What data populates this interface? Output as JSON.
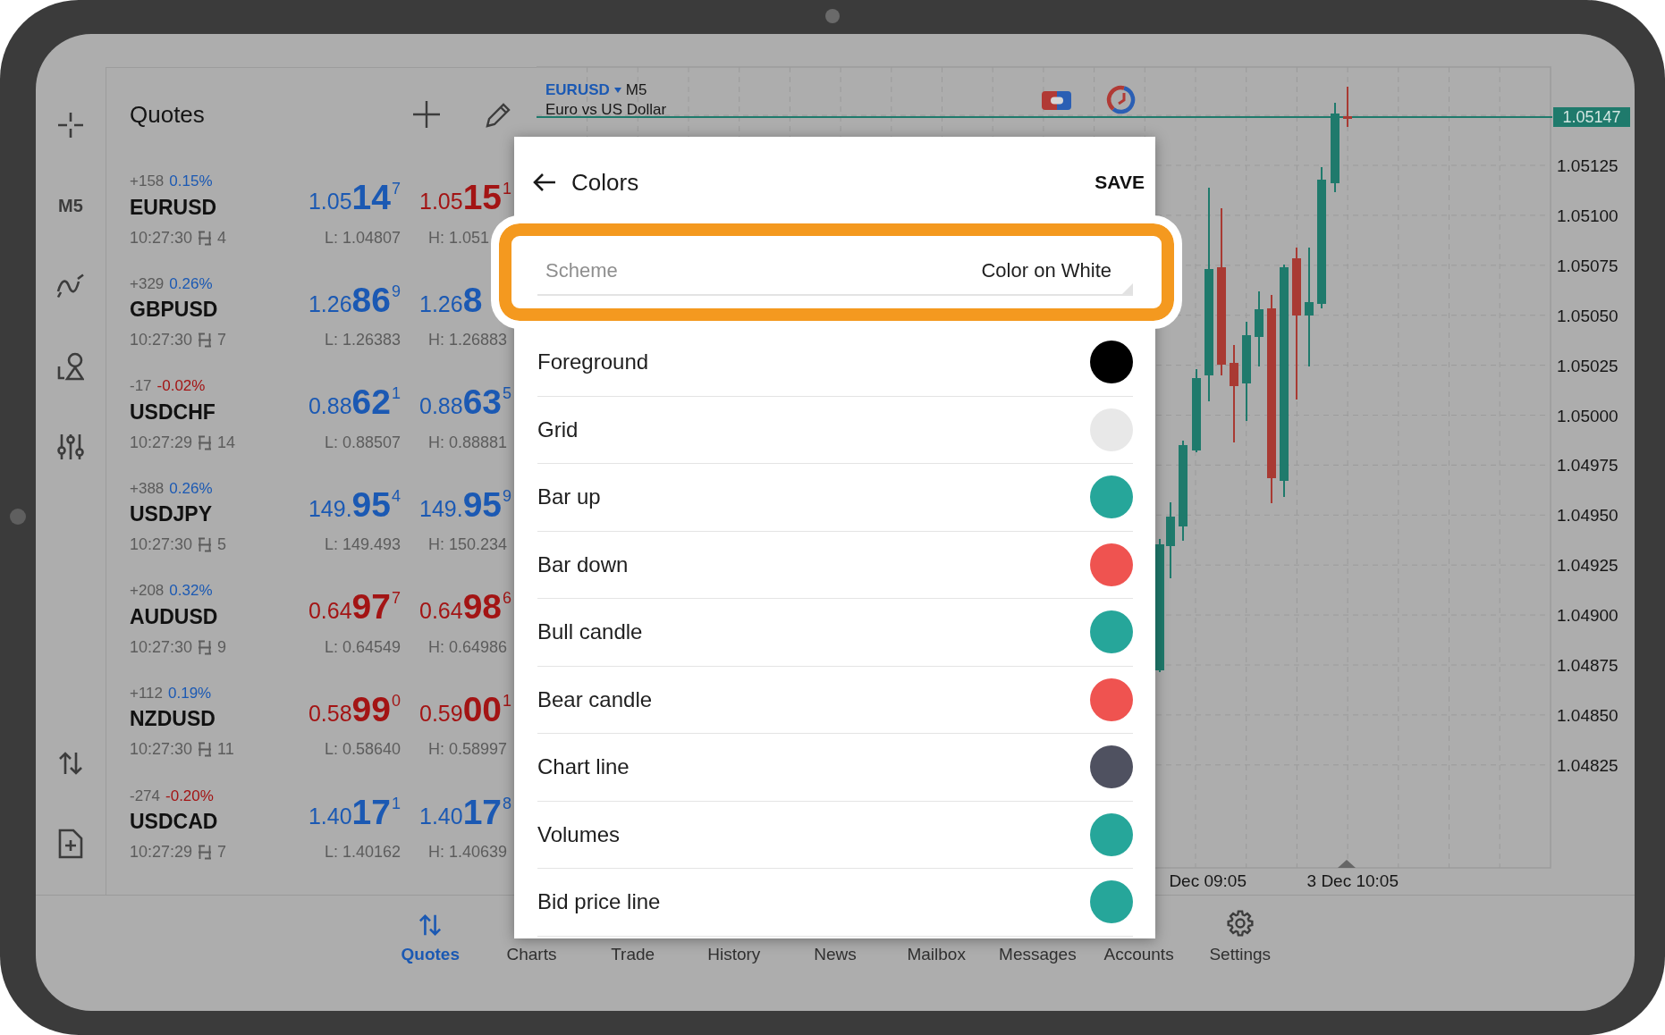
{
  "toolbar": {
    "timeframe": "M5"
  },
  "quotes": {
    "title": "Quotes",
    "items": [
      {
        "change": "+158",
        "percent": "0.15%",
        "rising": true,
        "symbol": "EURUSD",
        "time": "10:27:30",
        "spread": "4",
        "bid": {
          "lead": "1.05",
          "pips": "14",
          "tail": "7",
          "rising": true
        },
        "ask": {
          "lead": "1.05",
          "pips": "15",
          "tail": "1",
          "rising": false
        },
        "low": "L: 1.04807",
        "high": "H: 1.051"
      },
      {
        "change": "+329",
        "percent": "0.26%",
        "rising": true,
        "symbol": "GBPUSD",
        "time": "10:27:30",
        "spread": "7",
        "bid": {
          "lead": "1.26",
          "pips": "86",
          "tail": "9",
          "rising": true
        },
        "ask": {
          "lead": "1.26",
          "pips": "8",
          "rising": true
        },
        "low": "L: 1.26383",
        "high": "H: 1.26883"
      },
      {
        "change": "-17",
        "percent": "-0.02%",
        "rising": false,
        "symbol": "USDCHF",
        "time": "10:27:29",
        "spread": "14",
        "bid": {
          "lead": "0.88",
          "pips": "62",
          "tail": "1",
          "rising": true
        },
        "ask": {
          "lead": "0.88",
          "pips": "63",
          "tail": "5",
          "rising": true
        },
        "low": "L: 0.88507",
        "high": "H: 0.88881"
      },
      {
        "change": "+388",
        "percent": "0.26%",
        "rising": true,
        "symbol": "USDJPY",
        "time": "10:27:30",
        "spread": "5",
        "bid": {
          "lead": "149.",
          "pips": "95",
          "tail": "4",
          "rising": true
        },
        "ask": {
          "lead": "149.",
          "pips": "95",
          "tail": "9",
          "rising": true
        },
        "low": "L: 149.493",
        "high": "H: 150.234"
      },
      {
        "change": "+208",
        "percent": "0.32%",
        "rising": true,
        "symbol": "AUDUSD",
        "time": "10:27:30",
        "spread": "9",
        "bid": {
          "lead": "0.64",
          "pips": "97",
          "tail": "7",
          "rising": false
        },
        "ask": {
          "lead": "0.64",
          "pips": "98",
          "tail": "6",
          "rising": false
        },
        "low": "L: 0.64549",
        "high": "H: 0.64986"
      },
      {
        "change": "+112",
        "percent": "0.19%",
        "rising": true,
        "symbol": "NZDUSD",
        "time": "10:27:30",
        "spread": "11",
        "bid": {
          "lead": "0.58",
          "pips": "99",
          "tail": "0",
          "rising": false
        },
        "ask": {
          "lead": "0.59",
          "pips": "00",
          "tail": "1",
          "rising": false
        },
        "low": "L: 0.58640",
        "high": "H: 0.58997"
      },
      {
        "change": "-274",
        "percent": "-0.20%",
        "rising": false,
        "symbol": "USDCAD",
        "time": "10:27:29",
        "spread": "7",
        "bid": {
          "lead": "1.40",
          "pips": "17",
          "tail": "1",
          "rising": true
        },
        "ask": {
          "lead": "1.40",
          "pips": "17",
          "tail": "8",
          "rising": true
        },
        "low": "L: 1.40162",
        "high": "H: 1.40639"
      }
    ]
  },
  "chart": {
    "symbol": "EURUSD",
    "timeframe": "M5",
    "description": "Euro vs US Dollar",
    "current_price": "1.05147",
    "price_labels": [
      "1.05125",
      "1.05100",
      "1.05075",
      "1.05050",
      "1.05025",
      "1.05000",
      "1.04975",
      "1.04950",
      "1.04925",
      "1.04900",
      "1.04875",
      "1.04850",
      "1.04825"
    ],
    "time_labels": [
      "Dec 09:05",
      "3 Dec 10:05"
    ]
  },
  "dialog": {
    "title": "Colors",
    "action": "SAVE",
    "scheme": {
      "label": "Scheme",
      "value": "Color on White",
      "highlighted": true
    },
    "colors": [
      {
        "label": "Foreground",
        "color": "#000000"
      },
      {
        "label": "Grid",
        "color": "#e8e8e8"
      },
      {
        "label": "Bar up",
        "color": "#26a69a"
      },
      {
        "label": "Bar down",
        "color": "#ef5350"
      },
      {
        "label": "Bull candle",
        "color": "#26a69a"
      },
      {
        "label": "Bear candle",
        "color": "#ef5350"
      },
      {
        "label": "Chart line",
        "color": "#4f5160"
      },
      {
        "label": "Volumes",
        "color": "#26a69a"
      },
      {
        "label": "Bid price line",
        "color": "#26a69a"
      }
    ]
  },
  "tabs": [
    {
      "label": "Quotes",
      "selected": true
    },
    {
      "label": "Charts",
      "selected": false
    },
    {
      "label": "Trade",
      "selected": false
    },
    {
      "label": "History",
      "selected": false
    },
    {
      "label": "News",
      "selected": false
    },
    {
      "label": "Mailbox",
      "selected": false
    },
    {
      "label": "Messages",
      "selected": false
    },
    {
      "label": "Accounts",
      "selected": false
    },
    {
      "label": "Settings",
      "selected": false
    }
  ]
}
